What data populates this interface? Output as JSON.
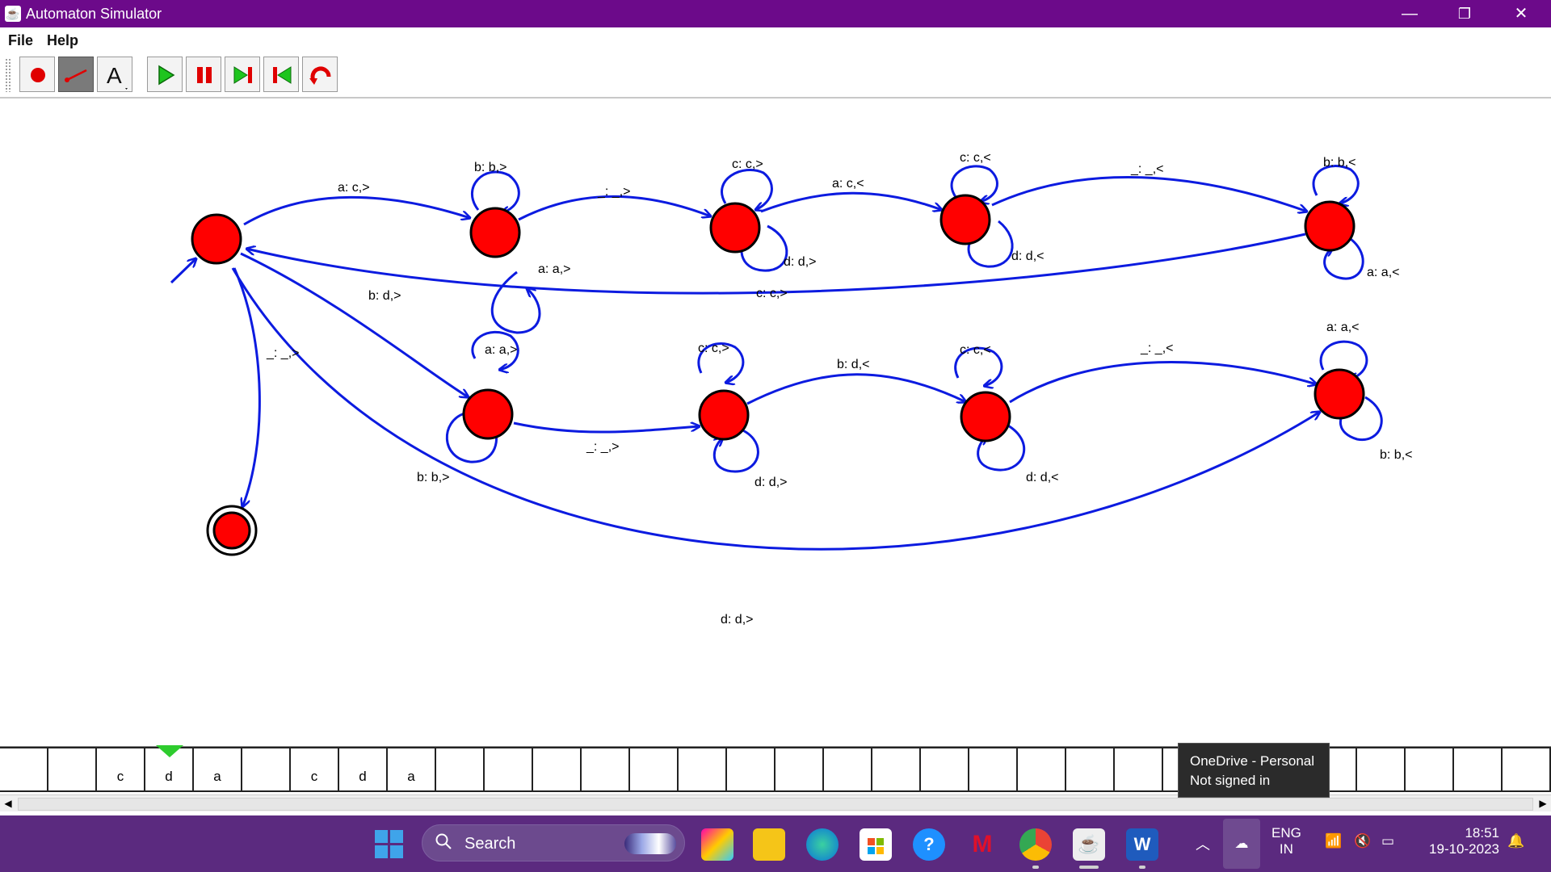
{
  "window": {
    "title": "Automaton Simulator",
    "controls": {
      "minimize": "—",
      "maximize": "❐",
      "close": "✕"
    }
  },
  "menu": {
    "file": "File",
    "help": "Help"
  },
  "toolbar": {
    "buttons": [
      {
        "name": "add-state",
        "icon": "red-dot-icon"
      },
      {
        "name": "add-transition",
        "icon": "transition-arrow-icon",
        "pressed": true
      },
      {
        "name": "add-text",
        "icon": "text-a-icon"
      },
      {
        "name": "run",
        "icon": "play-icon"
      },
      {
        "name": "pause",
        "icon": "pause-icon"
      },
      {
        "name": "step",
        "icon": "step-forward-icon"
      },
      {
        "name": "reset",
        "icon": "skip-back-icon"
      },
      {
        "name": "undo",
        "icon": "undo-curve-icon"
      }
    ]
  },
  "automaton": {
    "colors": {
      "state_fill": "#ff0000",
      "edge": "#0c1be0"
    },
    "labels": [
      "a: c,>",
      "b: b,>",
      "_: _,>",
      "c: c,>",
      "a: c,<",
      "c: c,<",
      "_: _,<",
      "b: b,<",
      "a: a,>",
      "d: d,>",
      "d: d,<",
      "a: a,<",
      "c: c,>",
      "b: d,>",
      "_: _,>",
      "a: a,>",
      "c: c,>",
      "b: d,<",
      "c: c,<",
      "_: _,<",
      "a: a,<",
      "_: _,>",
      "d: d,>",
      "d: d,<",
      "b: b,<",
      "b: b,>",
      "d: d,>"
    ]
  },
  "tape": {
    "cells": [
      "",
      "",
      "c",
      "d",
      "a",
      "",
      "c",
      "d",
      "a",
      "",
      "",
      "",
      "",
      "",
      "",
      "",
      "",
      "",
      "",
      "",
      "",
      "",
      "",
      "",
      "",
      "",
      "",
      "",
      "",
      "",
      "",
      ""
    ],
    "head_index": 3
  },
  "tooltip": {
    "line1": "OneDrive - Personal",
    "line2": "Not signed in"
  },
  "taskbar": {
    "search_placeholder": "Search",
    "apps": [
      "copilot-pre-icon",
      "file-explorer-icon",
      "edge-icon",
      "store-icon",
      "help-icon",
      "mcafee-icon",
      "chrome-icon",
      "java-icon",
      "word-icon"
    ],
    "tray": {
      "lang1": "ENG",
      "lang2": "IN",
      "time": "18:51",
      "date": "19-10-2023"
    }
  }
}
